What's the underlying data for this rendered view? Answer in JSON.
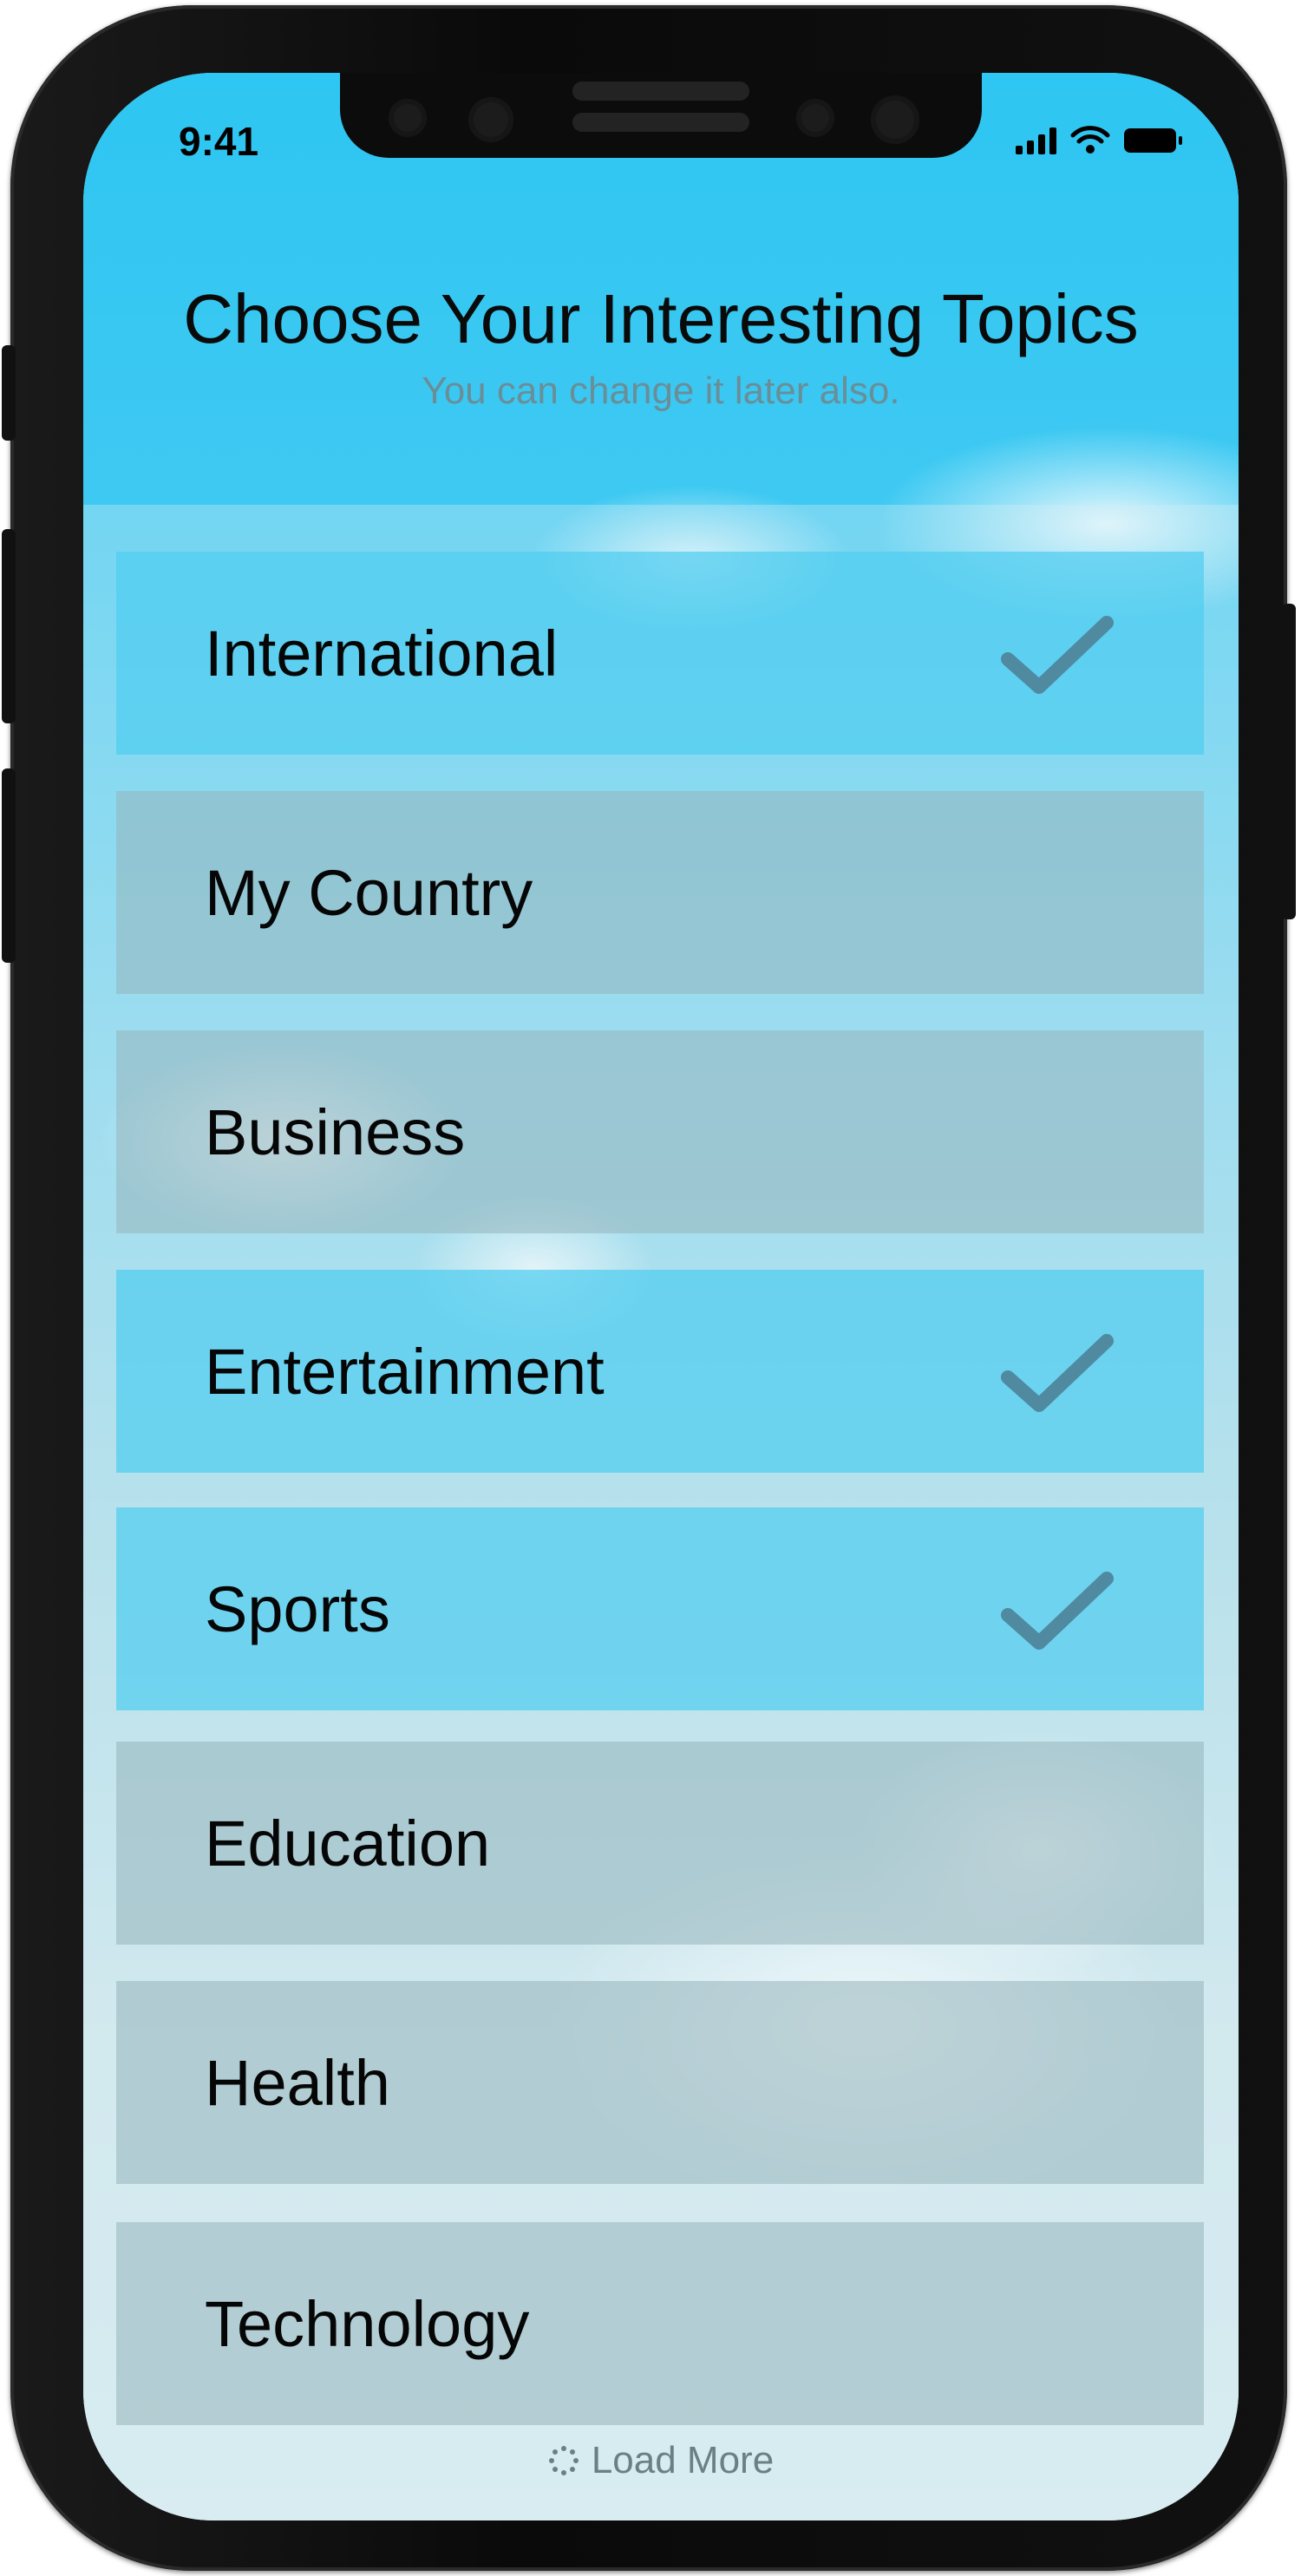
{
  "status_bar": {
    "time": "9:41"
  },
  "header": {
    "title": "Choose Your Interesting Topics",
    "subtitle": "You can change it later also."
  },
  "topics": [
    {
      "label": "International",
      "selected": true
    },
    {
      "label": "My Country",
      "selected": false
    },
    {
      "label": "Business",
      "selected": false
    },
    {
      "label": "Entertainment",
      "selected": true
    },
    {
      "label": "Sports",
      "selected": true
    },
    {
      "label": "Education",
      "selected": false
    },
    {
      "label": "Health",
      "selected": false
    },
    {
      "label": "Technology",
      "selected": false
    }
  ],
  "footer": {
    "load_more_label": "Load More",
    "load_more_icon": "spinner-icon"
  },
  "colors": {
    "sky_blue": "#2ec6f2",
    "selected_row": "#50cdf0",
    "check_mark": "#4f8aa0",
    "subtitle": "#6a8e98"
  }
}
